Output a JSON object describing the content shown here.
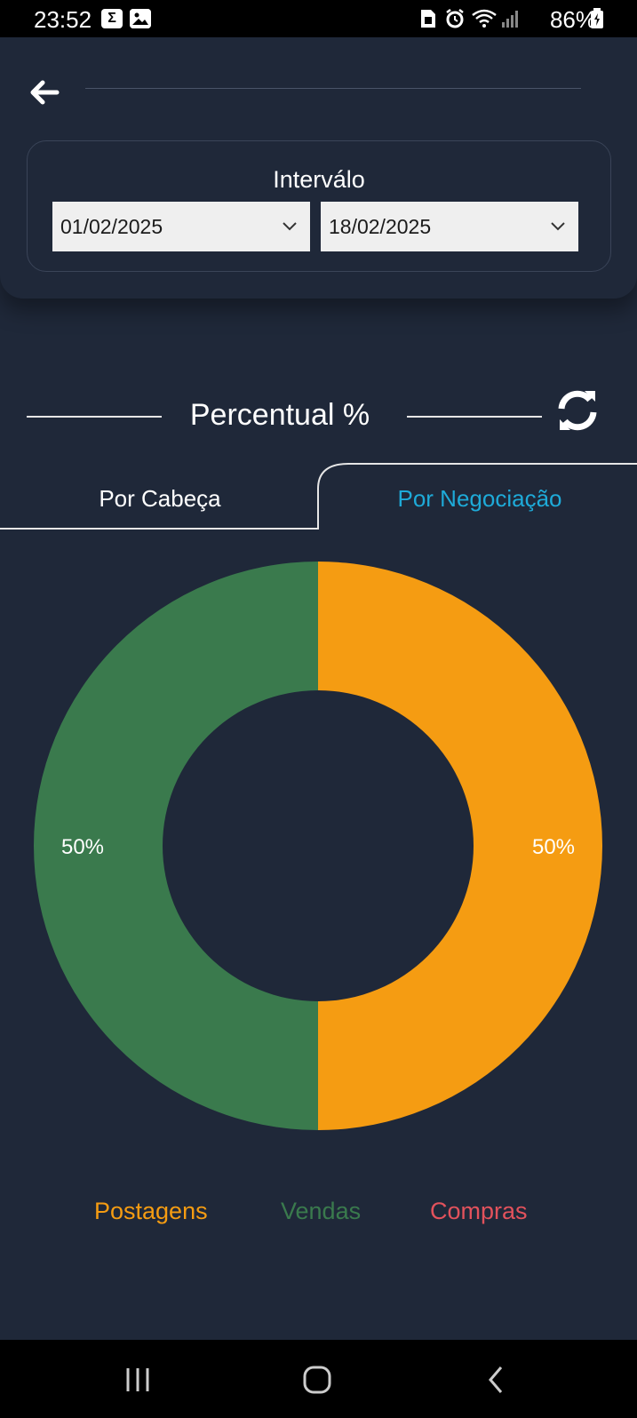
{
  "status_bar": {
    "time": "23:52",
    "battery": "86%",
    "icons": [
      "sigma-icon",
      "gallery-icon",
      "sim-icon",
      "alarm-icon",
      "wifi-icon",
      "signal-icon",
      "battery-charging-icon"
    ]
  },
  "header": {
    "back_icon": "arrow-left-icon"
  },
  "interval": {
    "label": "Interválo",
    "start_date": "01/02/2025",
    "end_date": "18/02/2025"
  },
  "section": {
    "title": "Percentual %",
    "refresh_icon": "refresh-icon"
  },
  "tabs": [
    {
      "label": "Por Cabeça",
      "active": false
    },
    {
      "label": "Por Negociação",
      "active": true
    }
  ],
  "colors": {
    "background": "#1f2839",
    "postagens": "#f59c12",
    "vendas": "#3a7a4d",
    "compras": "#e2525c",
    "active_tab": "#1eaad8"
  },
  "chart_data": {
    "type": "pie",
    "categories": [
      "Postagens",
      "Vendas"
    ],
    "values": [
      50,
      50
    ],
    "data_labels": [
      "50%",
      "50%"
    ],
    "colors": [
      "#f59c12",
      "#3a7a4d"
    ]
  },
  "legend": [
    {
      "label": "Postagens",
      "color": "#f59c12"
    },
    {
      "label": "Vendas",
      "color": "#3a7a4d"
    },
    {
      "label": "Compras",
      "color": "#e2525c"
    }
  ],
  "nav_bar": [
    "recent-apps-icon",
    "home-icon",
    "back-icon"
  ]
}
